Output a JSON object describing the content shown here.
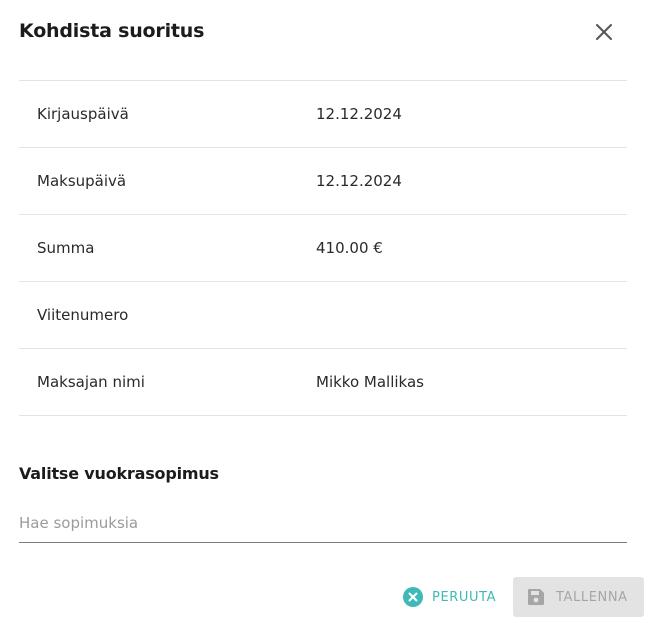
{
  "dialog": {
    "title": "Kohdista suoritus",
    "close_icon": "close-icon"
  },
  "details": [
    {
      "label": "Kirjauspäivä",
      "value": "12.12.2024"
    },
    {
      "label": "Maksupäivä",
      "value": "12.12.2024"
    },
    {
      "label": "Summa",
      "value": "410.00 €"
    },
    {
      "label": "Viitenumero",
      "value": ""
    },
    {
      "label": "Maksajan nimi",
      "value": "Mikko Mallikas"
    }
  ],
  "contract": {
    "section_title": "Valitse vuokrasopimus",
    "search_placeholder": "Hae sopimuksia",
    "search_value": ""
  },
  "actions": {
    "cancel_label": "PERUUTA",
    "cancel_icon": "cancel-circle-icon",
    "save_label": "TALLENNA",
    "save_icon": "floppy-disk-icon",
    "save_disabled": true
  },
  "colors": {
    "accent": "#3fb8b8",
    "disabled_bg": "#e3e3e3",
    "disabled_text": "#a6a6a6",
    "divider": "#e3e3e3"
  }
}
